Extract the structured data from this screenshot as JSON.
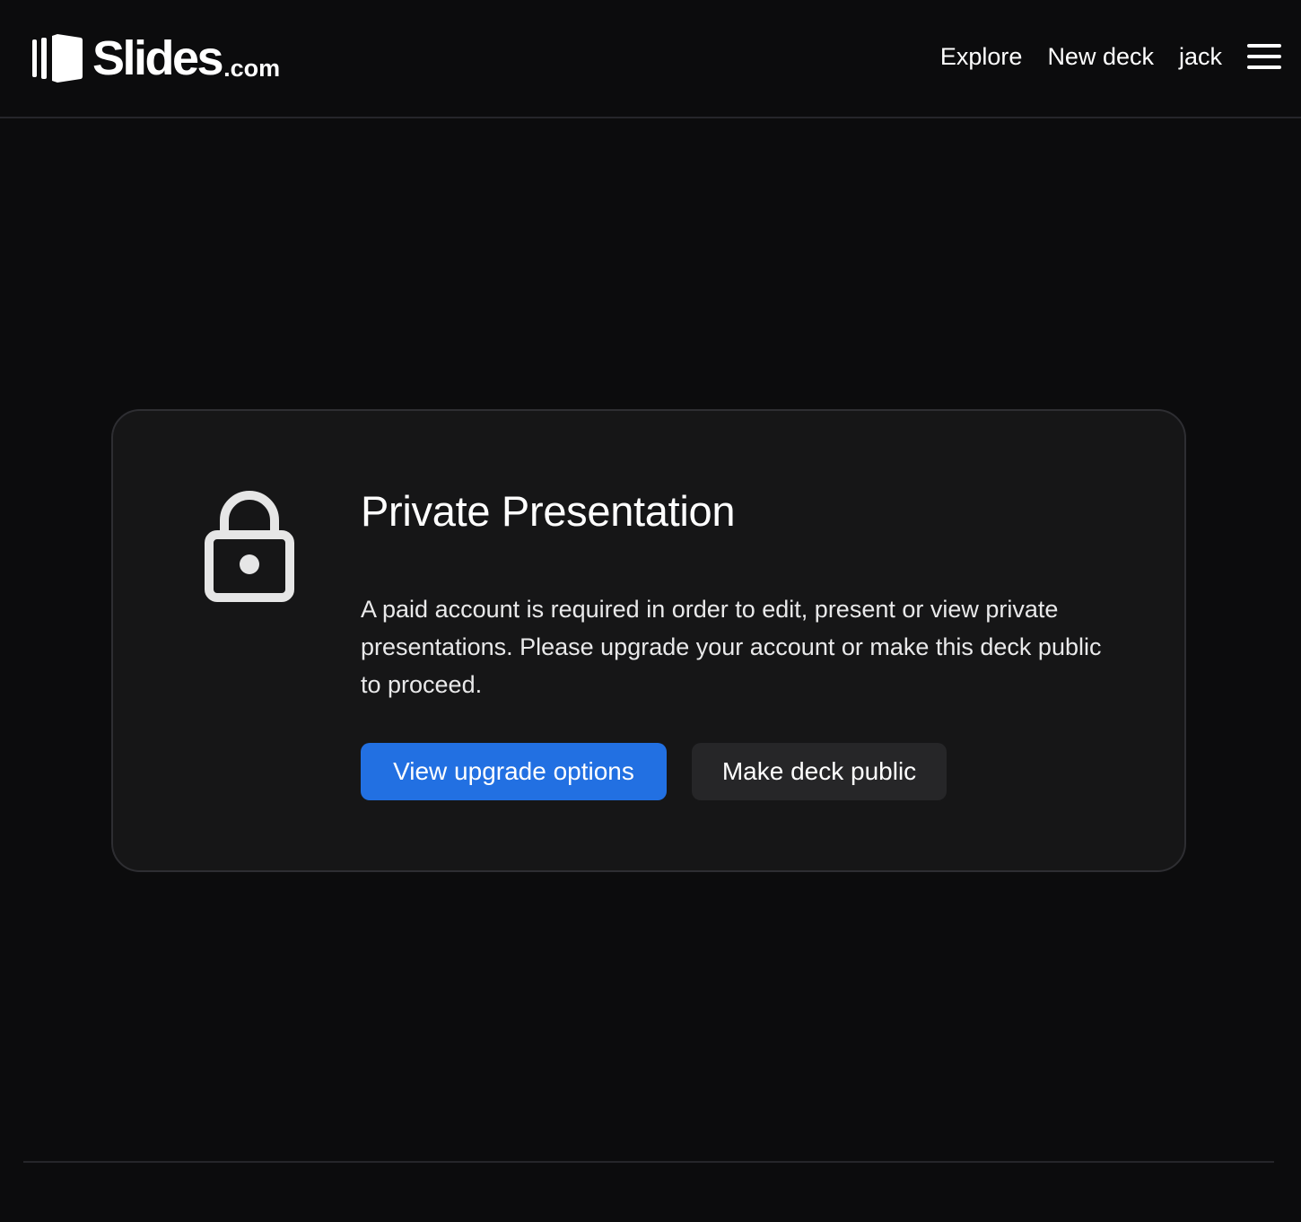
{
  "header": {
    "logo": {
      "word": "Slides",
      "suffix": ".com",
      "icon": "slides-logo-icon"
    },
    "nav": {
      "explore": "Explore",
      "new_deck": "New deck",
      "user": "jack",
      "menu_icon": "hamburger-menu-icon"
    }
  },
  "card": {
    "icon": "lock-icon",
    "title": "Private Presentation",
    "message": "A paid account is required in order to edit, present or view private presentations. Please upgrade your account or make this deck public to proceed.",
    "primary_button": "View upgrade options",
    "secondary_button": "Make deck public"
  },
  "colors": {
    "background": "#0c0c0d",
    "card": "#161617",
    "primary": "#2270e2",
    "secondary": "#262628"
  }
}
